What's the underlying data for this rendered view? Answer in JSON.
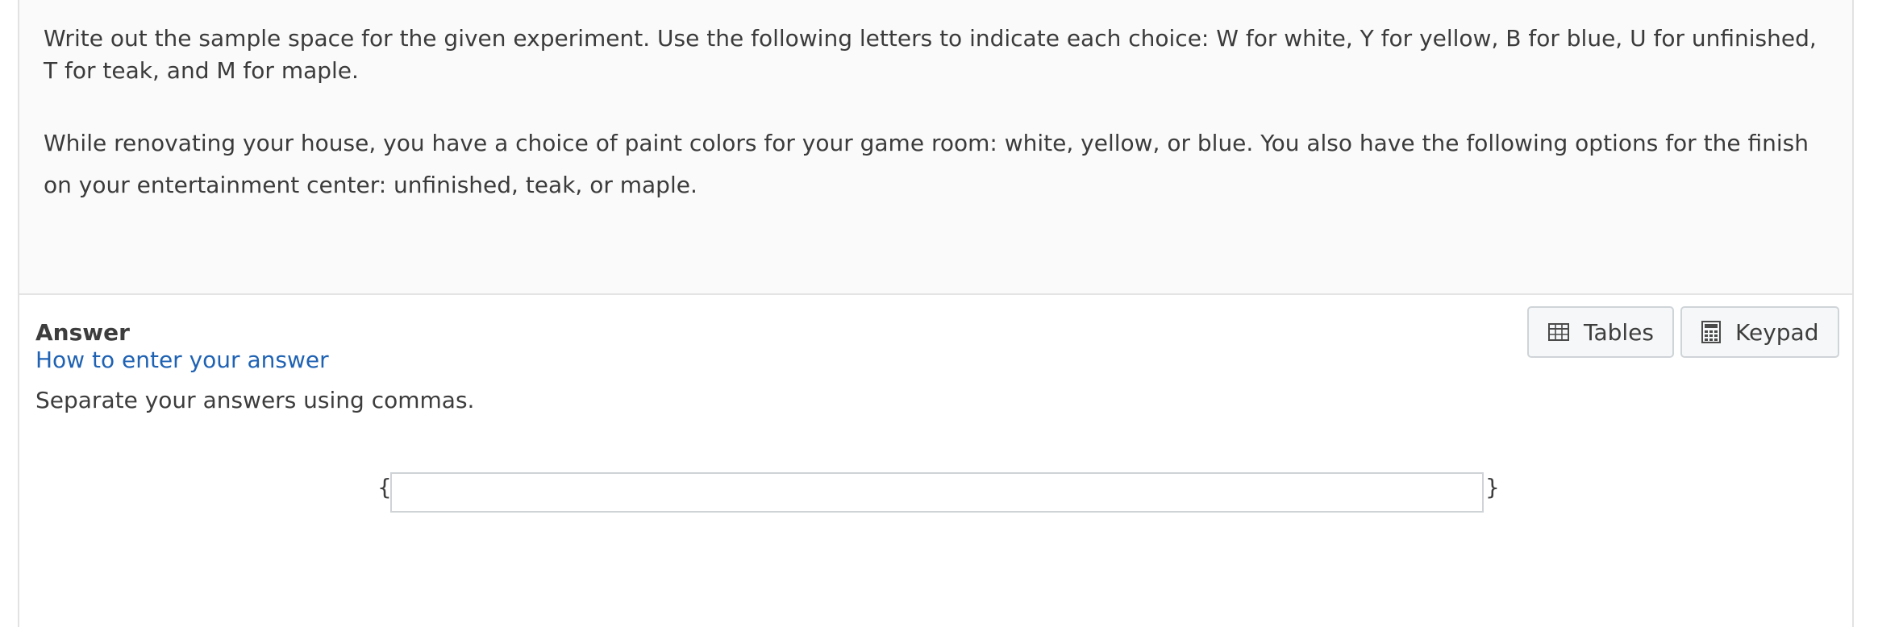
{
  "question": {
    "instructions": "Write out the sample space for the given experiment. Use the following letters to indicate each choice: W for white, Y for yellow, B for blue, U for unfinished, T for teak, and M for maple.",
    "scenario": "While renovating your house, you have a choice of paint colors for your game room: white, yellow, or blue.  You also have the following options for the finish on your entertainment center: unfinished, teak, or maple."
  },
  "answer": {
    "heading": "Answer",
    "help_link": "How to enter your answer",
    "hint": "Separate your answers using commas.",
    "open_brace": "{",
    "close_brace": "}",
    "input_value": ""
  },
  "toolbar": {
    "tables_label": "Tables",
    "tables_icon": "table-icon",
    "keypad_label": "Keypad",
    "keypad_icon": "calculator-icon"
  },
  "colors": {
    "link": "#1f62b3",
    "text": "#3b3b3b",
    "question_bg": "#fafafa",
    "button_border": "#cfd4d8"
  }
}
